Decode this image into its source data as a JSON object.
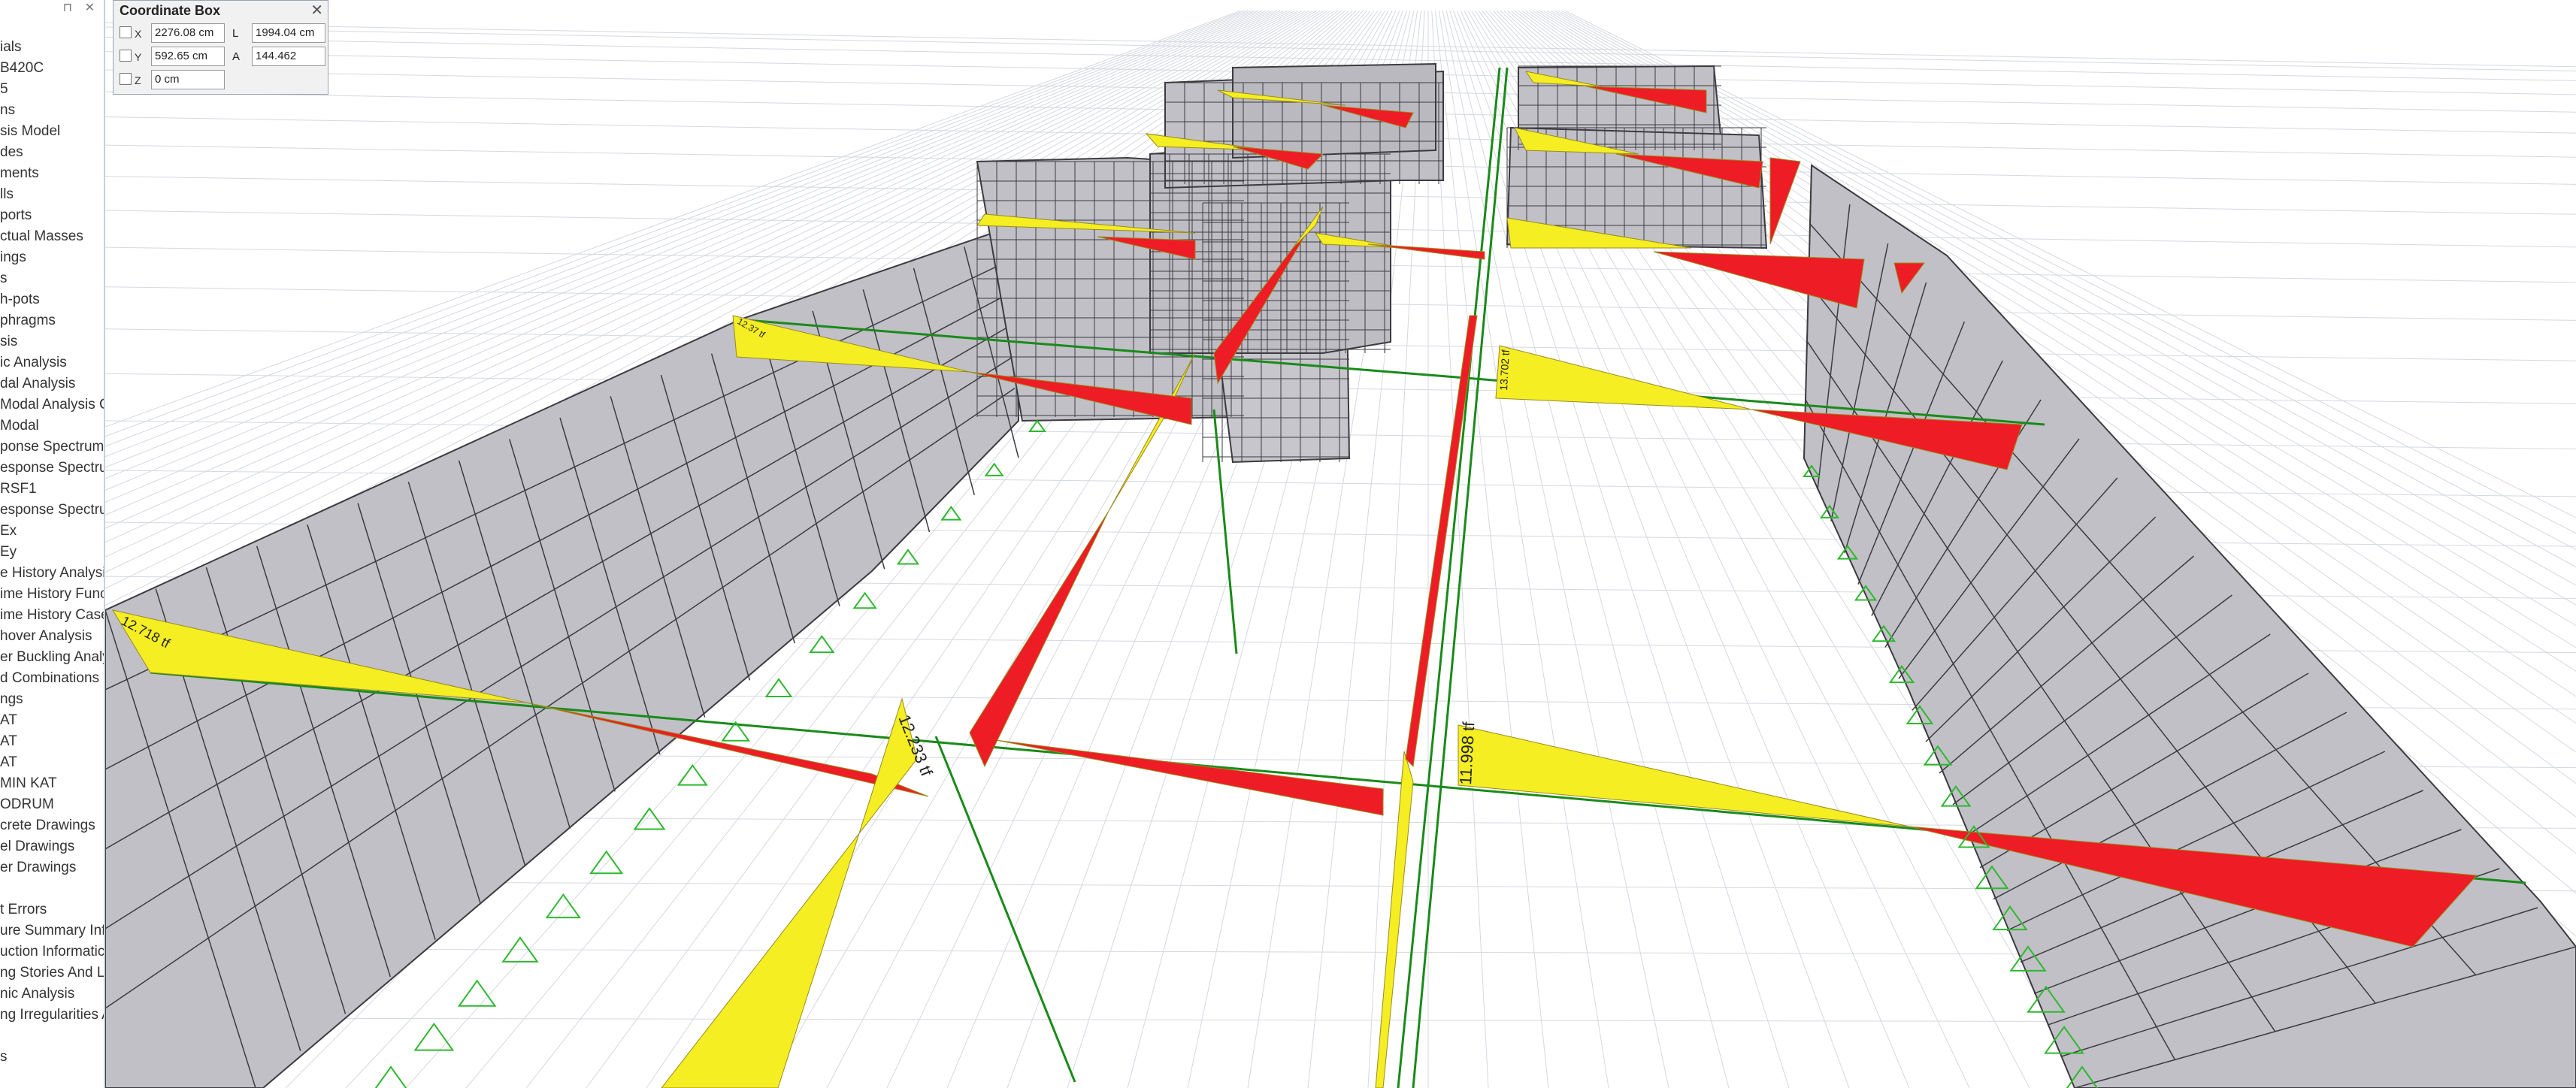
{
  "model_tree": {
    "items": [
      "ials",
      "B420C",
      "5",
      "ns",
      "sis Model",
      "des",
      "ments",
      "lls",
      "ports",
      "ctual Masses",
      "ings",
      "s",
      "h-pots",
      "phragms",
      "sis",
      "ic Analysis",
      "dal Analysis",
      "Modal Analysis Ca",
      "Modal",
      "ponse Spectrum",
      "esponse Spectrun",
      "RSF1",
      "esponse Spectrun",
      "Ex",
      "Ey",
      "e History Analysis",
      "ime History Funct",
      "ime History Cases",
      "hover Analysis",
      "er Buckling Analys",
      "d Combinations",
      "ngs",
      "AT",
      "AT",
      "AT",
      "MIN KAT",
      "ODRUM",
      "crete Drawings",
      "el Drawings",
      "er Drawings",
      "",
      "t Errors",
      "ure Summary Info",
      "uction Informatic",
      "ng Stories And Lo",
      "nic Analysis",
      "ng Irregularities A",
      "",
      "s"
    ]
  },
  "coordinate_box": {
    "title": "Coordinate Box",
    "x_label": "X",
    "x_value": "2276.08 cm",
    "y_label": "Y",
    "y_value": "592.65 cm",
    "z_label": "Z",
    "z_value": "0 cm",
    "l_label": "L",
    "l_value": "1994.04 cm",
    "a_label": "A",
    "a_value": "144.462"
  },
  "diagram_labels": {
    "near_left": "12.718 tf",
    "near_center": "12.233 tf",
    "near_right": "11.998 tf",
    "mid_right": "13.702 tf",
    "far_left": "12.37 tf"
  },
  "colors": {
    "wall_fill": "#c0c0c6",
    "wall_mesh": "#3b3b40",
    "positive_diagram": "#f4ee22",
    "negative_diagram": "#ee1c24",
    "support_symbol": "#2fb82f",
    "frame_line": "#1a8a1a",
    "ground_grid": "#d4d8e0"
  }
}
